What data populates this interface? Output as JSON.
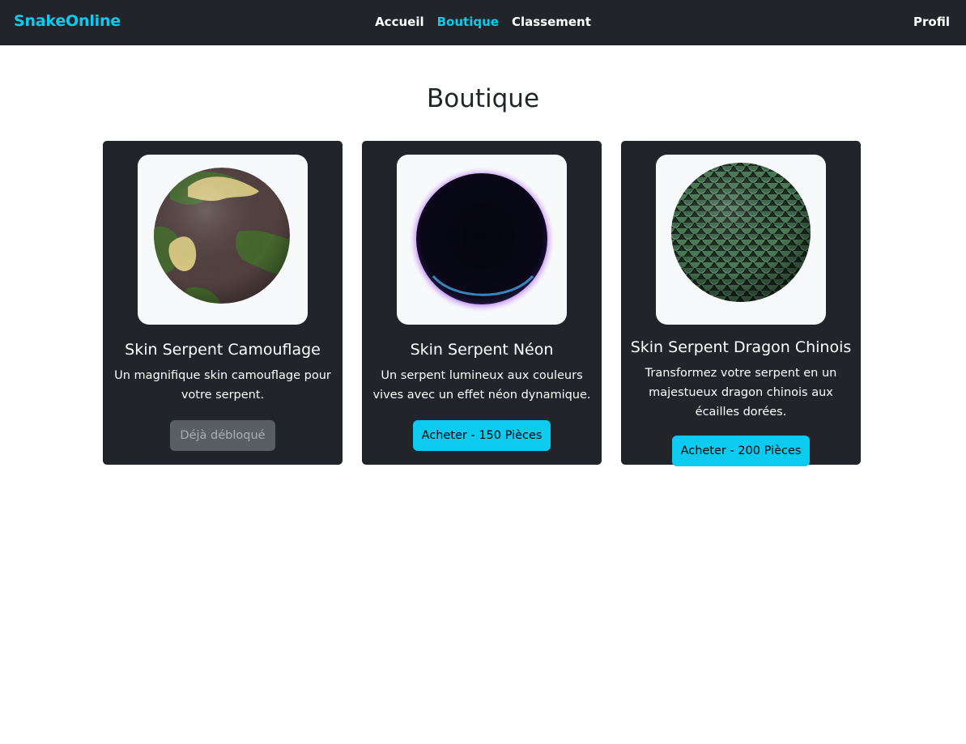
{
  "navbar": {
    "brand": "SnakeOnline",
    "links": [
      {
        "label": "Accueil"
      },
      {
        "label": "Boutique",
        "active": true
      },
      {
        "label": "Classement"
      }
    ],
    "profile": "Profil"
  },
  "page": {
    "title": "Boutique"
  },
  "products": [
    {
      "title": "Skin Serpent Camouflage",
      "description": "Un magnifique skin camouflage pour votre serpent.",
      "button": "Déjà débloqué",
      "button_state": "disabled",
      "image_icon": "camouflage-sphere"
    },
    {
      "title": "Skin Serpent Néon",
      "description": "Un serpent lumineux aux couleurs vives avec un effet néon dynamique.",
      "button": "Acheter - 150 Pièces",
      "button_state": "enabled",
      "image_icon": "neon-sphere"
    },
    {
      "title": "Skin Serpent Dragon Chinois",
      "description": "Transformez votre serpent en un majestueux dragon chinois aux écailles dorées.",
      "button": "Acheter - 200 Pièces",
      "button_state": "enabled",
      "image_icon": "dragon-scale-sphere"
    }
  ],
  "colors": {
    "navbar_bg": "#212529",
    "accent": "#0dcaf0",
    "card_bg": "#212529",
    "disabled_button": "#585e64"
  }
}
